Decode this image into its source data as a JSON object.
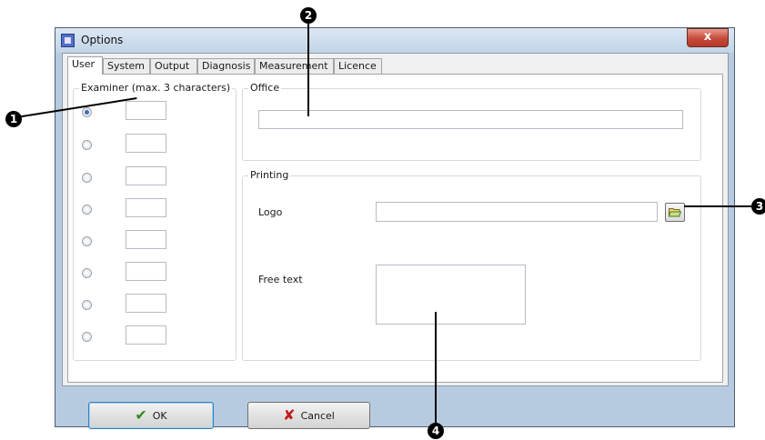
{
  "window": {
    "title": "Options",
    "close_label": "x"
  },
  "tabs": [
    {
      "label": "User",
      "active": true
    },
    {
      "label": "System",
      "active": false
    },
    {
      "label": "Output",
      "active": false
    },
    {
      "label": "Diagnosis",
      "active": false
    },
    {
      "label": "Measurement",
      "active": false
    },
    {
      "label": "Licence",
      "active": false
    }
  ],
  "examiner": {
    "group_title": "Examiner (max. 3 characters)",
    "rows": [
      {
        "selected": true,
        "value": ""
      },
      {
        "selected": false,
        "value": ""
      },
      {
        "selected": false,
        "value": ""
      },
      {
        "selected": false,
        "value": ""
      },
      {
        "selected": false,
        "value": ""
      },
      {
        "selected": false,
        "value": ""
      },
      {
        "selected": false,
        "value": ""
      },
      {
        "selected": false,
        "value": ""
      }
    ]
  },
  "office": {
    "group_title": "Office",
    "value": ""
  },
  "printing": {
    "group_title": "Printing",
    "logo_label": "Logo",
    "logo_value": "",
    "free_text_label": "Free text",
    "free_text_value": ""
  },
  "buttons": {
    "ok_label": "OK",
    "cancel_label": "Cancel"
  },
  "callouts": [
    "1",
    "2",
    "3",
    "4"
  ],
  "icons": {
    "browse": "folder-open-icon",
    "ok": "checkmark-icon",
    "cancel": "x-mark-icon",
    "app": "app-icon"
  }
}
